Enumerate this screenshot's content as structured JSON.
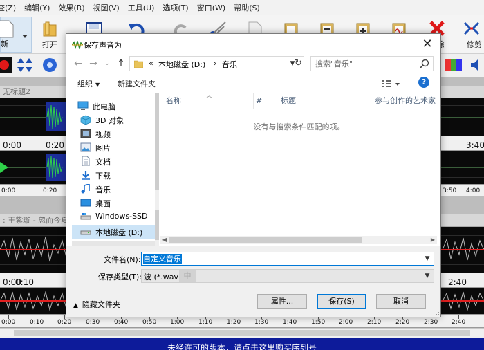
{
  "app": {
    "menu": [
      "查(Z)",
      "编辑(Y)",
      "效果(R)",
      "视图(V)",
      "工具(U)",
      "选项(T)",
      "窗口(W)",
      "帮助(S)"
    ],
    "toolbar": {
      "new_label": "新",
      "open_label": "打开",
      "delete_label": "除",
      "trim_label": "修剪"
    },
    "tracks": [
      {
        "title": "无标题2"
      },
      {
        "title": ": 王紫璇 - 忽而今夏"
      }
    ],
    "ruler_top": [
      "0:00",
      "0:20",
      "3:40"
    ],
    "ruler_mid": [
      "0:00",
      "0:20",
      "3:50",
      "4:00"
    ],
    "ruler_mid2": [
      "0:00",
      "0:10",
      "2:40"
    ],
    "ruler_bottom": [
      "0:00",
      "0:10",
      "0:20",
      "0:30",
      "0:40",
      "0:50",
      "1:00",
      "1:10",
      "1:20",
      "1:30",
      "1:40",
      "1:50",
      "2:00",
      "2:10",
      "2:20",
      "2:30",
      "2:40"
    ],
    "status_text": "未经许可的版本，请点击这里购买序列号"
  },
  "dialog": {
    "title": "保存声音为",
    "close_label": "✕",
    "breadcrumb": [
      "«",
      "本地磁盘 (D:)",
      "›",
      "音乐"
    ],
    "search_placeholder": "搜索\"音乐\"",
    "commands": {
      "organize": "组织",
      "new_folder": "新建文件夹"
    },
    "help_label": "?",
    "nav_items": [
      {
        "label": "此电脑",
        "icon": "pc-icon"
      },
      {
        "label": "3D 对象",
        "icon": "3d-objects-icon"
      },
      {
        "label": "视频",
        "icon": "video-icon"
      },
      {
        "label": "图片",
        "icon": "pictures-icon"
      },
      {
        "label": "文档",
        "icon": "documents-icon"
      },
      {
        "label": "下载",
        "icon": "download-icon"
      },
      {
        "label": "音乐",
        "icon": "music-icon"
      },
      {
        "label": "桌面",
        "icon": "desktop-icon"
      },
      {
        "label": "Windows-SSD",
        "icon": "drive-icon"
      },
      {
        "label": "本地磁盘 (D:)",
        "icon": "drive-icon"
      }
    ],
    "columns": [
      "名称",
      "#",
      "标题",
      "参与创作的艺术家"
    ],
    "empty_message": "没有与搜索条件匹配的项。",
    "filename_label": "文件名(N):",
    "filename_value": "自定义音乐",
    "filetype_label": "保存类型(T):",
    "filetype_value": "波 (*.wav)",
    "filetype_extra": "中",
    "hide_folders": "隐藏文件夹",
    "buttons": {
      "properties": "属性...",
      "save": "保存(S)",
      "cancel": "取消"
    }
  },
  "colors": {
    "accent": "#0078d7",
    "status_bar": "#0d1b9a",
    "selected_nav": "#cce4f7",
    "waveform_green": "#2fd24a",
    "waveform_red": "#e02020"
  }
}
